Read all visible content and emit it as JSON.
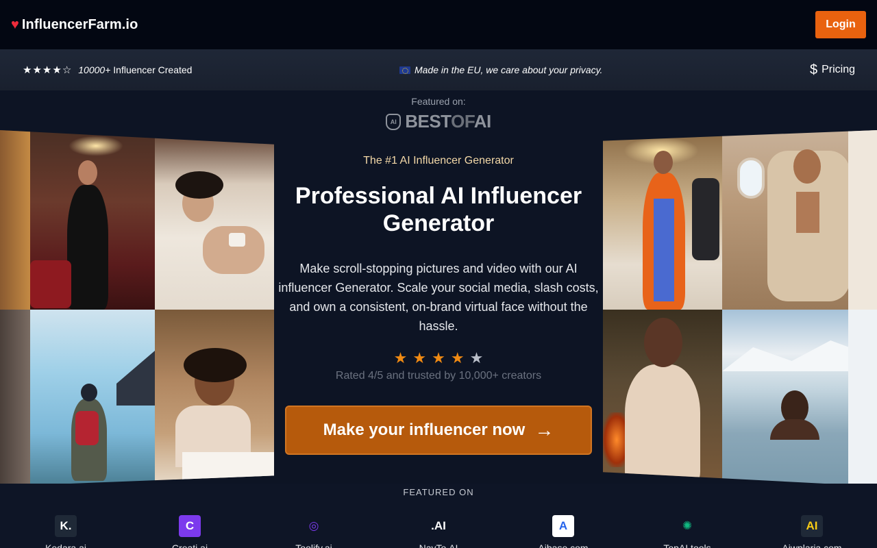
{
  "brand": {
    "name": "InfluencerFarm.io"
  },
  "nav": {
    "login_label": "Login"
  },
  "infobar": {
    "stars": {
      "rating": 4,
      "max": 5
    },
    "count_bold": "10000+",
    "count_text": "Influencer Created",
    "privacy_text": "Made in the EU, we care about your privacy.",
    "pricing_label": "Pricing"
  },
  "featured_top": {
    "label": "Featured on:",
    "logo_text_a": "BEST",
    "logo_text_b": "OF",
    "logo_text_c": "AI",
    "badge_text": "AI"
  },
  "hero": {
    "tagline": "The #1 AI Influencer Generator",
    "title": "Professional AI Influencer Generator",
    "description": "Make scroll-stopping pictures and video with our AI influencer Generator. Scale your social media, slash costs, and own a consistent, on-brand virtual face without the hassle.",
    "rating": {
      "value": 4,
      "max": 5
    },
    "rated_text": "Rated 4/5 and trusted by 10,000+ creators",
    "cta_label": "Make your influencer now"
  },
  "featured_bottom": {
    "label": "FEATURED ON",
    "logos": [
      {
        "name": "Kedara.ai",
        "glyph": "K.",
        "bg": "#1f2937",
        "fg": "#ffffff"
      },
      {
        "name": "Creati.ai",
        "glyph": "C",
        "bg": "#7c3aed",
        "fg": "#ffffff"
      },
      {
        "name": "Toolify.ai",
        "glyph": "◎",
        "bg": "transparent",
        "fg": "#7c3aed"
      },
      {
        "name": "NavTo.AI",
        "glyph": ".AI",
        "bg": "transparent",
        "fg": "#ffffff"
      },
      {
        "name": "Aibase.com",
        "glyph": "A",
        "bg": "#ffffff",
        "fg": "#2563eb"
      },
      {
        "name": "TopAI.tools",
        "glyph": "✺",
        "bg": "transparent",
        "fg": "#10b981"
      },
      {
        "name": "Aiwplaria.com",
        "glyph": "AI",
        "bg": "#1f2937",
        "fg": "#facc15"
      }
    ]
  },
  "colors": {
    "accent": "#e9620f",
    "cta": "#b65a0c",
    "star": "#f08a13",
    "heart": "#ef2b3b"
  }
}
